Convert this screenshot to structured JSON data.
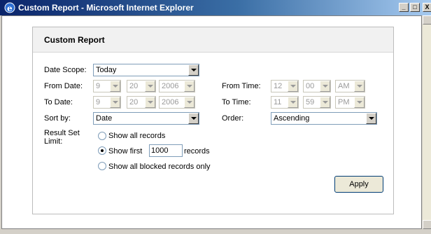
{
  "window": {
    "title": "Custom Report - Microsoft Internet Explorer",
    "btn_minimize": "_",
    "btn_maximize": "□",
    "btn_close": "X"
  },
  "form": {
    "heading": "Custom Report",
    "date_scope_label": "Date Scope:",
    "date_scope_value": "Today",
    "from_date_label": "From Date:",
    "from_month": "9",
    "from_day": "20",
    "from_year": "2006",
    "to_date_label": "To Date:",
    "to_month": "9",
    "to_day": "20",
    "to_year": "2006",
    "from_time_label": "From Time:",
    "from_hour": "12",
    "from_min": "00",
    "from_ampm": "AM",
    "to_time_label": "To Time:",
    "to_hour": "11",
    "to_min": "59",
    "to_ampm": "PM",
    "sort_by_label": "Sort by:",
    "sort_by_value": "Date",
    "order_label": "Order:",
    "order_value": "Ascending",
    "result_limit_label_1": "Result Set",
    "result_limit_label_2": "Limit:",
    "opt_all": "Show all records",
    "opt_first_prefix": "Show first",
    "opt_first_count": "1000",
    "opt_first_suffix": "records",
    "opt_blocked": "Show all blocked records only",
    "selected_option": "first",
    "apply_label": "Apply"
  },
  "colors": {
    "titlebar_start": "#0a246a",
    "titlebar_end": "#a6caf0",
    "panel_header_bg": "#f1f1f1"
  }
}
